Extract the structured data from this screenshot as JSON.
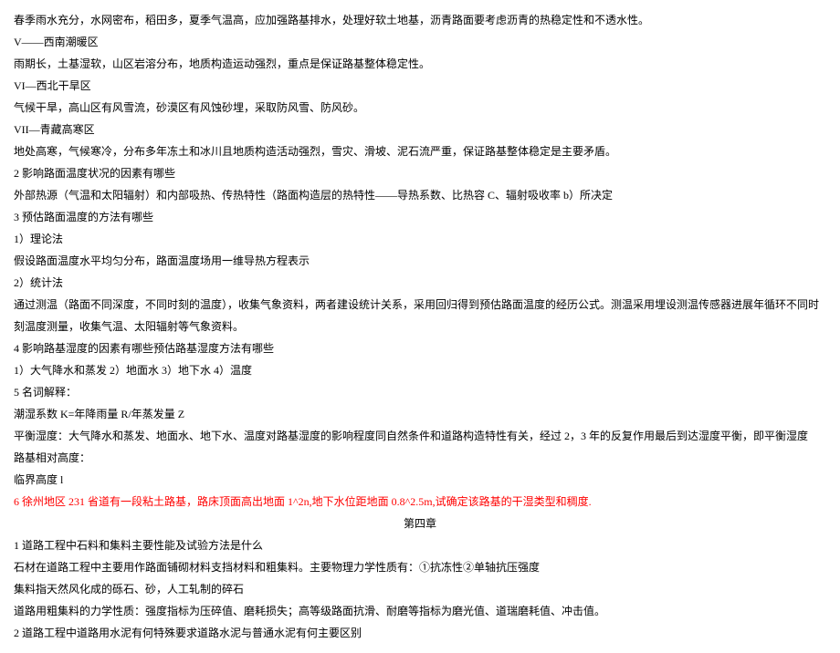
{
  "lines": [
    {
      "text": "春季雨水充分，水网密布，稻田多，夏季气温高，应加强路基排水，处理好软土地基，沥青路面要考虑沥青的热稳定性和不透水性。",
      "red": false,
      "center": false
    },
    {
      "text": "V——西南潮暖区",
      "red": false,
      "center": false
    },
    {
      "text": "雨期长，土基湿软，山区岩溶分布，地质构造运动强烈，重点是保证路基整体稳定性。",
      "red": false,
      "center": false
    },
    {
      "text": "VI—西北干旱区",
      "red": false,
      "center": false
    },
    {
      "text": "气候干旱，高山区有风雪流，砂漠区有风蚀砂埋，采取防风雪、防风砂。",
      "red": false,
      "center": false
    },
    {
      "text": "VII—青藏高寒区",
      "red": false,
      "center": false
    },
    {
      "text": "地处高寒，气候寒冷，分布多年冻土和冰川且地质构造活动强烈，雪灾、滑坡、泥石流严重，保证路基整体稳定是主要矛盾。",
      "red": false,
      "center": false
    },
    {
      "text": "2 影响路面温度状况的因素有哪些",
      "red": false,
      "center": false
    },
    {
      "text": "外部热源（气温和太阳辐射）和内部吸热、传热特性（路面构造层的热特性——导热系数、比热容 C、辐射吸收率 b）所决定",
      "red": false,
      "center": false
    },
    {
      "text": "3 预估路面温度的方法有哪些",
      "red": false,
      "center": false
    },
    {
      "text": "1）理论法",
      "red": false,
      "center": false
    },
    {
      "text": "假设路面温度水平均匀分布，路面温度场用一维导热方程表示",
      "red": false,
      "center": false
    },
    {
      "text": "2）统计法",
      "red": false,
      "center": false
    },
    {
      "text": "通过测温（路面不同深度，不同时刻的温度），收集气象资料，两者建设统计关系，采用回归得到预估路面温度的经历公式。测温采用埋设测温传感器进展年循环不同时刻温度测量，收集气温、太阳辐射等气象资料。",
      "red": false,
      "center": false
    },
    {
      "text": "4 影响路基湿度的因素有哪些预估路基湿度方法有哪些",
      "red": false,
      "center": false
    },
    {
      "text": "1）大气降水和蒸发 2）地面水 3）地下水 4）温度",
      "red": false,
      "center": false
    },
    {
      "text": "5 名词解释：",
      "red": false,
      "center": false
    },
    {
      "text": "潮湿系数 K=年降雨量 R/年蒸发量 Z",
      "red": false,
      "center": false
    },
    {
      "text": "平衡湿度：大气降水和蒸发、地面水、地下水、温度对路基湿度的影响程度同自然条件和道路构造特性有关，经过 2，3 年的反复作用最后到达湿度平衡，即平衡湿度",
      "red": false,
      "center": false
    },
    {
      "text": "路基相对高度：",
      "red": false,
      "center": false
    },
    {
      "text": "临界高度 l",
      "red": false,
      "center": false
    },
    {
      "text": "6 徐州地区 231 省道有一段粘土路基，路床顶面高出地面 1^2n,地下水位距地面 0.8^2.5m,试确定该路基的干湿类型和稠度.",
      "red": true,
      "center": false
    },
    {
      "text": "第四章",
      "red": false,
      "center": true
    },
    {
      "text": "1 道路工程中石料和集料主要性能及试验方法是什么",
      "red": false,
      "center": false
    },
    {
      "text": "石材在道路工程中主要用作路面铺砌材料支挡材料和粗集料。主要物理力学性质有：①抗冻性②单轴抗压强度",
      "red": false,
      "center": false
    },
    {
      "text": "集料指天然风化成的砾石、砂，人工轧制的碎石",
      "red": false,
      "center": false
    },
    {
      "text": "道路用粗集料的力学性质：强度指标为压碎值、磨耗损失；高等级路面抗滑、耐磨等指标为磨光值、道瑞磨耗值、冲击值。",
      "red": false,
      "center": false
    },
    {
      "text": "2 道路工程中道路用水泥有何特殊要求道路水泥与普通水泥有何主要区别",
      "red": false,
      "center": false
    }
  ]
}
